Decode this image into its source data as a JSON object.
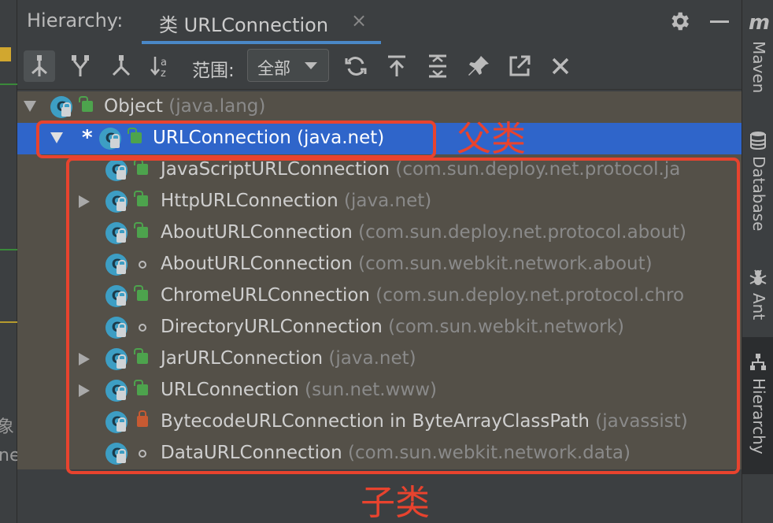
{
  "header": {
    "title": "Hierarchy:",
    "tab_label": "类 URLConnection",
    "tab_close": "×"
  },
  "toolbar": {
    "scope_label": "范围:",
    "scope_value": "全部"
  },
  "tree": {
    "rows": [
      {
        "name": "Object",
        "pkg": "(java.lang)"
      },
      {
        "name": "URLConnection (java.net)",
        "pkg": ""
      },
      {
        "name": "JavaScriptURLConnection",
        "pkg": "(com.sun.deploy.net.protocol.ja"
      },
      {
        "name": "HttpURLConnection",
        "pkg": "(java.net)"
      },
      {
        "name": "AboutURLConnection",
        "pkg": "(com.sun.deploy.net.protocol.about)"
      },
      {
        "name": "AboutURLConnection",
        "pkg": "(com.sun.webkit.network.about)"
      },
      {
        "name": "ChromeURLConnection",
        "pkg": "(com.sun.deploy.net.protocol.chro"
      },
      {
        "name": "DirectoryURLConnection",
        "pkg": "(com.sun.webkit.network)"
      },
      {
        "name": "JarURLConnection",
        "pkg": "(java.net)"
      },
      {
        "name": "URLConnection",
        "pkg": "(sun.net.www)"
      },
      {
        "name": "BytecodeURLConnection in ByteArrayClassPath",
        "pkg": "(javassist)"
      },
      {
        "name": "DataURLConnection",
        "pkg": "(com.sun.webkit.network.data)"
      }
    ],
    "star": "*",
    "class_letter": "C"
  },
  "right_stripe": {
    "maven_logo": "m",
    "maven": "Maven",
    "database": "Database",
    "ant": "Ant",
    "hierarchy": "Hierarchy"
  },
  "left_strip": {
    "text1": "象",
    "text2": "ne"
  },
  "annotations": {
    "parent": "父类",
    "children": "子类",
    "color": "#e8432e"
  },
  "colors": {
    "selection": "#2f65ca",
    "tree_bg": "#545048",
    "class_icon": "#3d9ec4",
    "public_green": "#4da34d",
    "private_red": "#c75a32"
  }
}
